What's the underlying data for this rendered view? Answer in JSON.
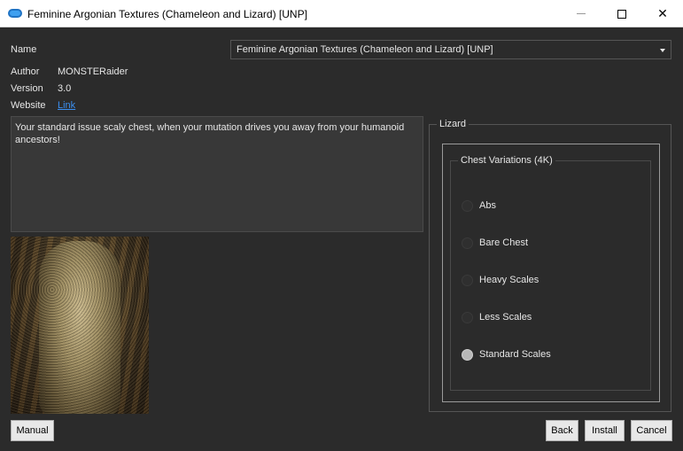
{
  "window": {
    "title": "Feminine Argonian Textures (Chameleon and Lizard) [UNP]",
    "minimize_icon": "minimize-icon",
    "maximize_icon": "maximize-icon",
    "close_icon": "close-icon",
    "close_glyph": "✕"
  },
  "info": {
    "name_label": "Name",
    "name_value": "Feminine Argonian Textures (Chameleon and Lizard) [UNP]",
    "author_label": "Author",
    "author_value": "MONSTERaider",
    "version_label": "Version",
    "version_value": "3.0",
    "website_label": "Website",
    "website_link": "Link"
  },
  "description": "Your standard issue scaly chest, when your mutation drives you away from your humanoid ancestors!",
  "options": {
    "group_title": "Lizard",
    "subgroup_title": "Chest Variations (4K)",
    "items": [
      {
        "label": "Abs",
        "checked": false
      },
      {
        "label": "Bare Chest",
        "checked": false
      },
      {
        "label": "Heavy Scales",
        "checked": false
      },
      {
        "label": "Less Scales",
        "checked": false
      },
      {
        "label": "Standard Scales",
        "checked": true
      }
    ]
  },
  "buttons": {
    "manual": "Manual",
    "back": "Back",
    "install": "Install",
    "cancel": "Cancel"
  }
}
